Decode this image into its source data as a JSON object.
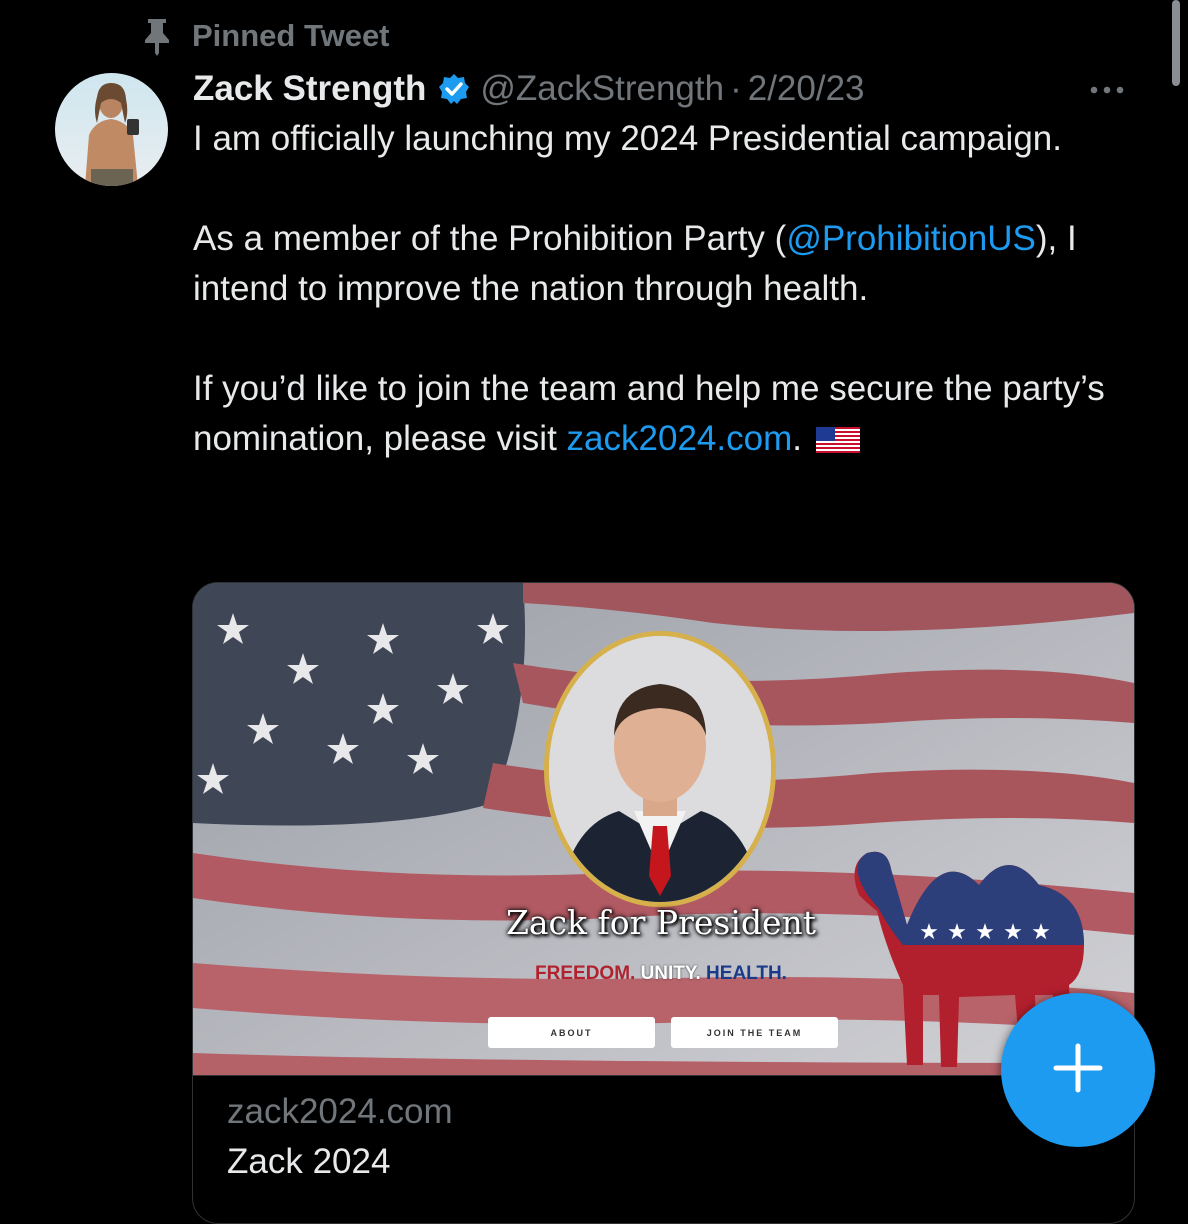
{
  "pinned": {
    "label": "Pinned Tweet"
  },
  "tweet": {
    "author": {
      "display_name": "Zack Strength",
      "handle": "@ZackStrength",
      "verified": true
    },
    "separator": "·",
    "date": "2/20/23",
    "text": {
      "line1": "I am officially launching my 2024 Presidential campaign.",
      "p2_before": "As a member of the Prohibition Party (",
      "p2_mention": "@ProhibitionUS",
      "p2_after": "), I intend to improve the nation through health.",
      "p3_before": "If you’d like to join the team and help me secure the party’s nomination, please visit ",
      "p3_link": "zack2024.com",
      "p3_after": ".",
      "flag_emoji": "🇺🇸"
    },
    "card": {
      "site_title": "Zack for President",
      "slogan": {
        "part1": "FREEDOM.",
        "part2": "UNITY.",
        "part3": "HEALTH."
      },
      "buttons": {
        "about": "ABOUT",
        "join": "JOIN THE TEAM"
      },
      "domain": "zack2024.com",
      "title": "Zack 2024"
    }
  },
  "icons": {
    "pin": "pin-icon",
    "verified": "verified-badge-icon",
    "more": "more-horizontal-icon",
    "compose": "plus-icon"
  },
  "colors": {
    "background": "#000000",
    "text": "#e7e9ea",
    "muted": "#71767b",
    "link": "#1d9bf0",
    "fab": "#1d9bf0"
  }
}
